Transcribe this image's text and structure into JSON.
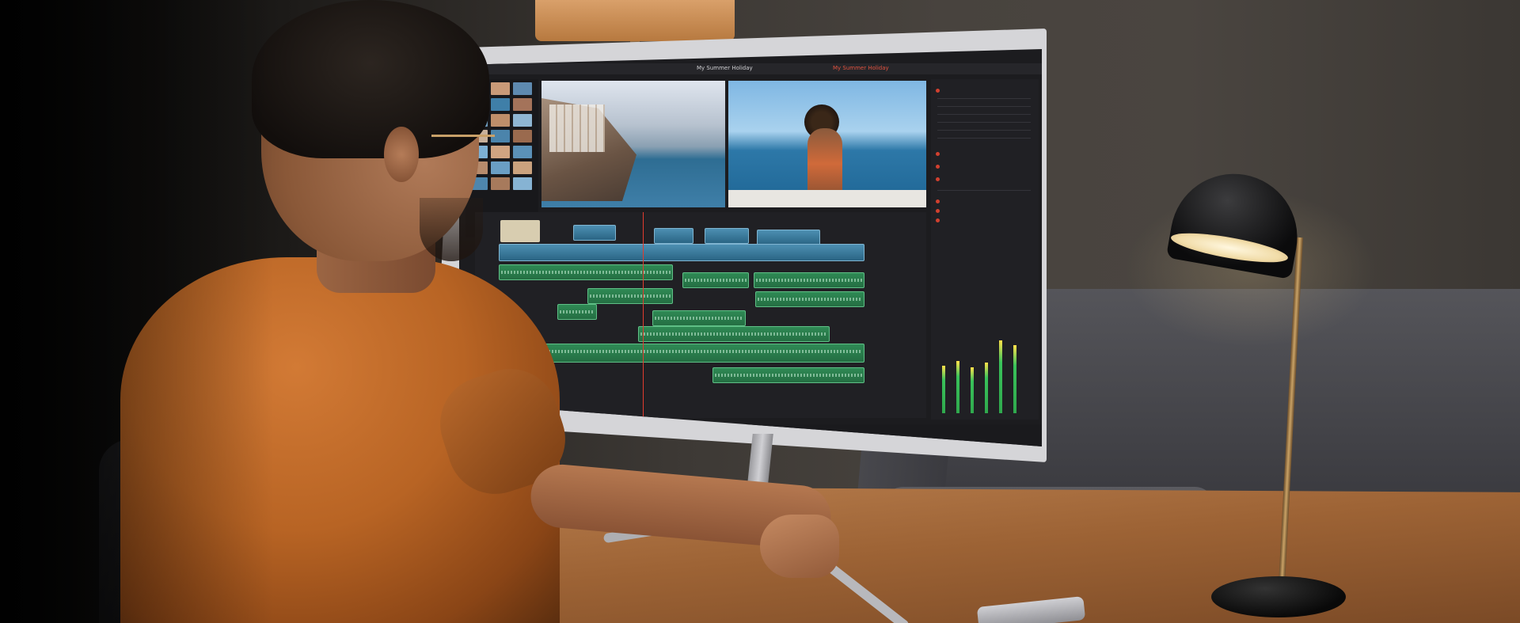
{
  "scene": {
    "description_free": true,
    "colors": {
      "shirt": "#b86424",
      "wall": "#48433e",
      "desk": "#9d6335",
      "couch": "#4a4a4f",
      "timeline_audio": "#2f8a55",
      "timeline_video": "#4d8fb2",
      "playhead": "#e23b2e"
    }
  },
  "monitor_ui": {
    "project_title": "My Summer Holiday",
    "red_title": "My Summer Holiday"
  }
}
